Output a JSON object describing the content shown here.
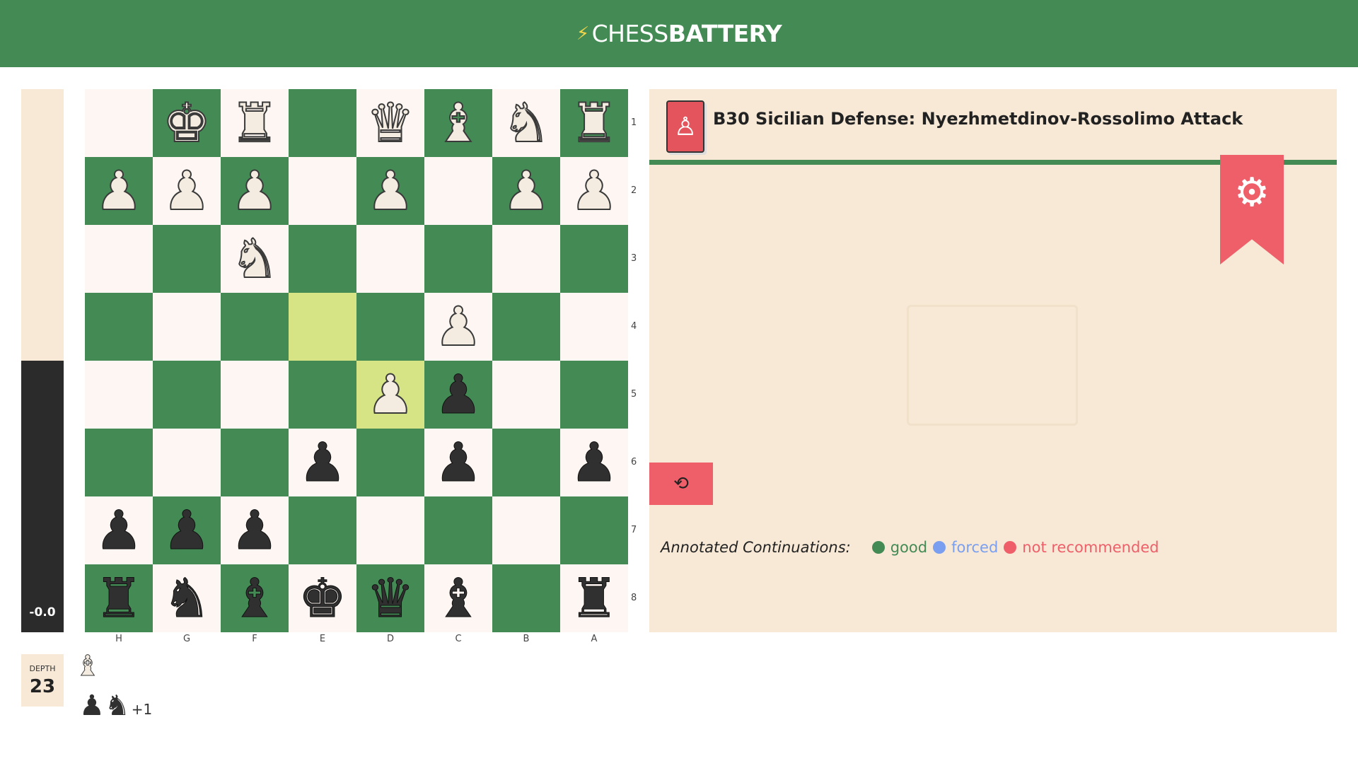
{
  "header": {
    "logo_icon": "lightning-bolt",
    "logo_light": "CHESS",
    "logo_bold": "BATTERY"
  },
  "evaluation": {
    "score": "-0.0",
    "white_fraction": 0.5
  },
  "board": {
    "files": [
      "H",
      "G",
      "F",
      "E",
      "D",
      "C",
      "B",
      "A"
    ],
    "ranks": [
      "1",
      "2",
      "3",
      "4",
      "5",
      "6",
      "7",
      "8"
    ],
    "rows": [
      [
        "",
        "wK",
        "wR",
        "",
        "wQ",
        "wB",
        "wN",
        "wR"
      ],
      [
        "wP",
        "wP",
        "wP",
        "",
        "wP",
        "",
        "wP",
        "wP"
      ],
      [
        "",
        "",
        "wN",
        "",
        "",
        "",
        "",
        ""
      ],
      [
        "",
        "",
        "",
        "",
        "",
        "wP",
        "",
        ""
      ],
      [
        "",
        "",
        "",
        "",
        "wP",
        "bP",
        "",
        ""
      ],
      [
        "",
        "",
        "",
        "bP",
        "",
        "bP",
        "",
        "bP"
      ],
      [
        "bP",
        "bP",
        "bP",
        "",
        "",
        "",
        "",
        ""
      ],
      [
        "bR",
        "bN",
        "bB",
        "bK",
        "bQ",
        "bB",
        "",
        "bR"
      ]
    ],
    "highlighted": [
      "E4",
      "D5"
    ],
    "colors": {
      "light": "#fdf6f3",
      "dark": "#438a55",
      "highlight": "#d7e486"
    }
  },
  "opening": {
    "icon": "opening-book-icon",
    "name": "B30 Sicilian Defense: Nyezhmetdinov-Rossolimo Attack"
  },
  "annotated": {
    "label": "Annotated Continuations:",
    "legend": [
      {
        "label": "good",
        "color": "#438a55"
      },
      {
        "label": "forced",
        "color": "#7b9ff0"
      },
      {
        "label": "not recommended",
        "color": "#ef5f6a"
      }
    ]
  },
  "depth": {
    "label": "DEPTH",
    "value": "23"
  },
  "captured": {
    "by_black": [
      "wB"
    ],
    "by_white": [
      "bP",
      "bN"
    ],
    "advantage": "+1"
  }
}
